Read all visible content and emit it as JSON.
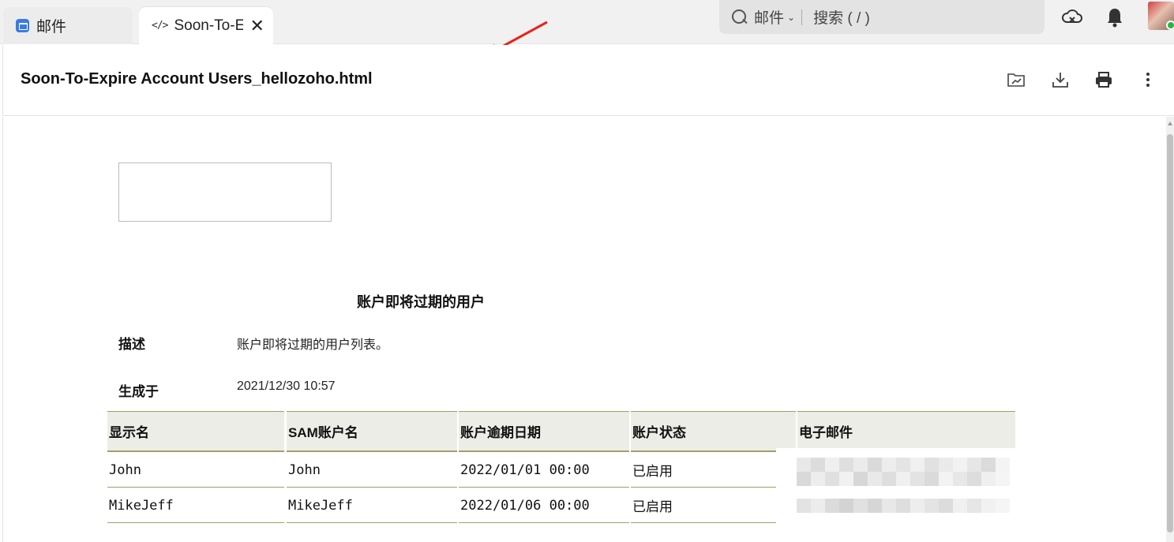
{
  "tabs": {
    "mail_label": "邮件",
    "file_label": "Soon-To-E",
    "file_code_glyph": "</>",
    "close_glyph": "✕"
  },
  "search": {
    "scope_label": "邮件",
    "placeholder": "搜索 ( / )"
  },
  "file": {
    "title": "Soon-To-Expire Account Users_hellozoho.html"
  },
  "report": {
    "title": "账户即将过期的用户",
    "description_label": "描述",
    "description_value": "账户即将过期的用户列表。",
    "generated_label": "生成于",
    "generated_value": "2021/12/30 10:57"
  },
  "table": {
    "headers": [
      "显示名",
      "SAM账户名",
      "账户逾期日期",
      "账户状态",
      "电子邮件"
    ],
    "rows": [
      [
        "John",
        "John",
        "2022/01/01 00:00",
        "已启用",
        ""
      ],
      [
        "MikeJeff",
        "MikeJeff",
        "2022/01/06 00:00",
        "已启用",
        ""
      ]
    ]
  },
  "colors": {
    "accent_blue": "#3a7be0",
    "table_rule": "#a0a06a",
    "header_fill": "#ededE7",
    "arrow_red": "#e8231b",
    "status_green": "#2cb34a"
  }
}
